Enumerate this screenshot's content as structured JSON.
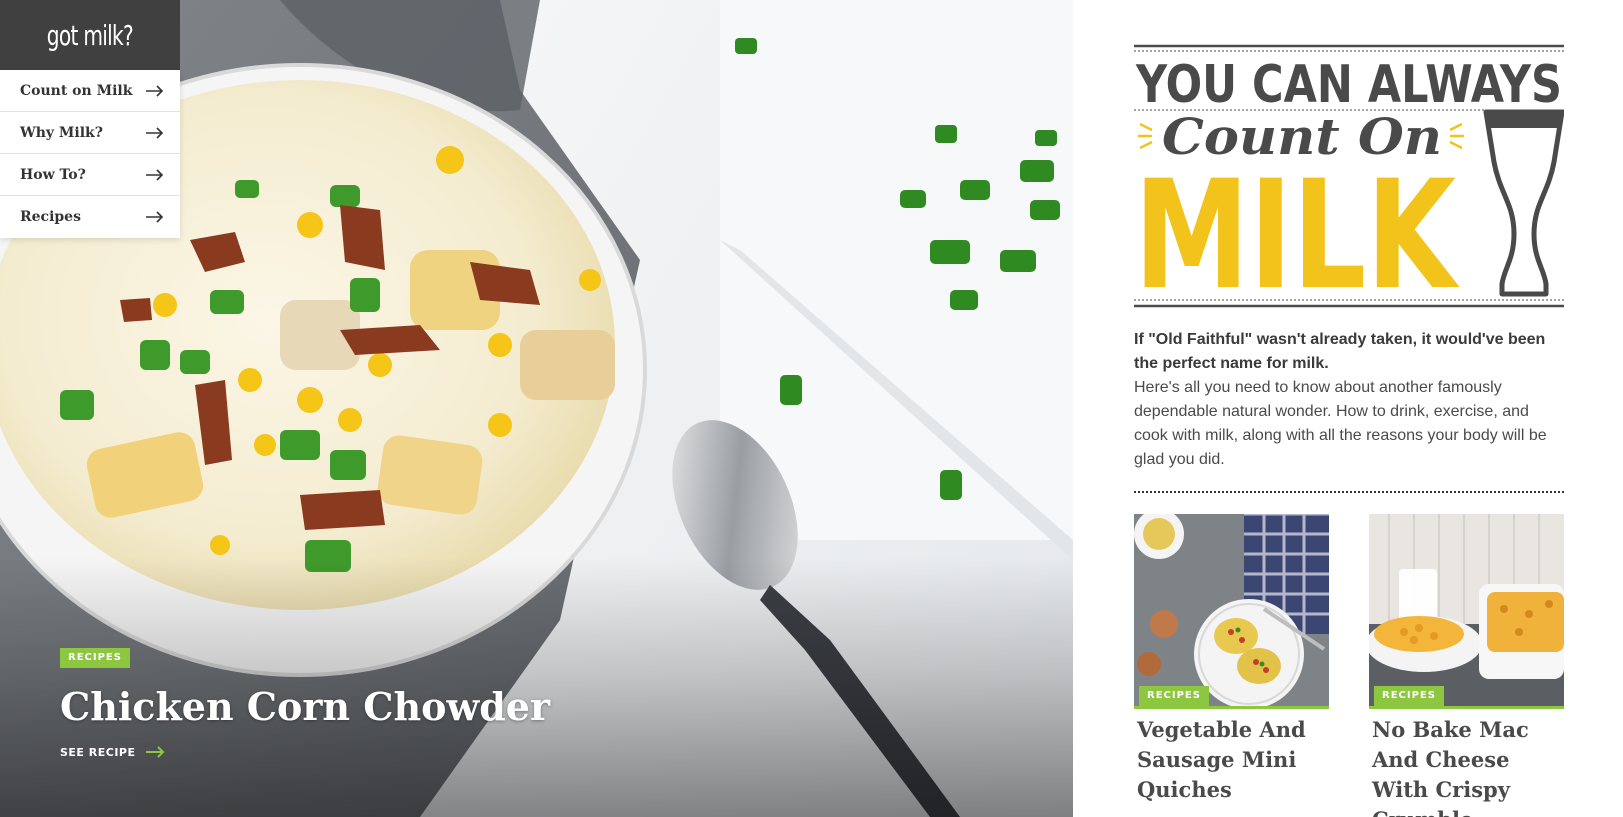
{
  "logo": {
    "text": "got milk?"
  },
  "nav": {
    "items": [
      {
        "label": "Count on Milk"
      },
      {
        "label": "Why Milk?"
      },
      {
        "label": "How To?"
      },
      {
        "label": "Recipes"
      }
    ]
  },
  "hero": {
    "badge": "RECIPES",
    "title": "Chicken Corn Chowder",
    "cta": "SEE RECIPE"
  },
  "headline": {
    "line1": "YOU CAN ALWAYS",
    "line2": "Count On",
    "line3": "MILK"
  },
  "intro": {
    "lead": "If \"Old Faithful\" wasn't already taken, it would've been the perfect name for milk.",
    "body": "Here's all you need to know about another famously dependable natural wonder. How to drink, exercise, and cook with milk, along with all the reasons your body will be glad you did."
  },
  "cards": [
    {
      "badge": "RECIPES",
      "title": "Vegetable And Sausage Mini Quiches"
    },
    {
      "badge": "RECIPES",
      "title": "No Bake Mac And Cheese With Crispy Crumble"
    }
  ],
  "colors": {
    "accent_green": "#8dc63f",
    "brand_yellow": "#f2c31a",
    "dark_gray": "#404040",
    "text_gray": "#4a4a4a"
  },
  "icons": {
    "nav_arrow": "arrow-right-icon",
    "cta_arrow": "arrow-right-icon",
    "glass": "milk-glass-icon"
  }
}
